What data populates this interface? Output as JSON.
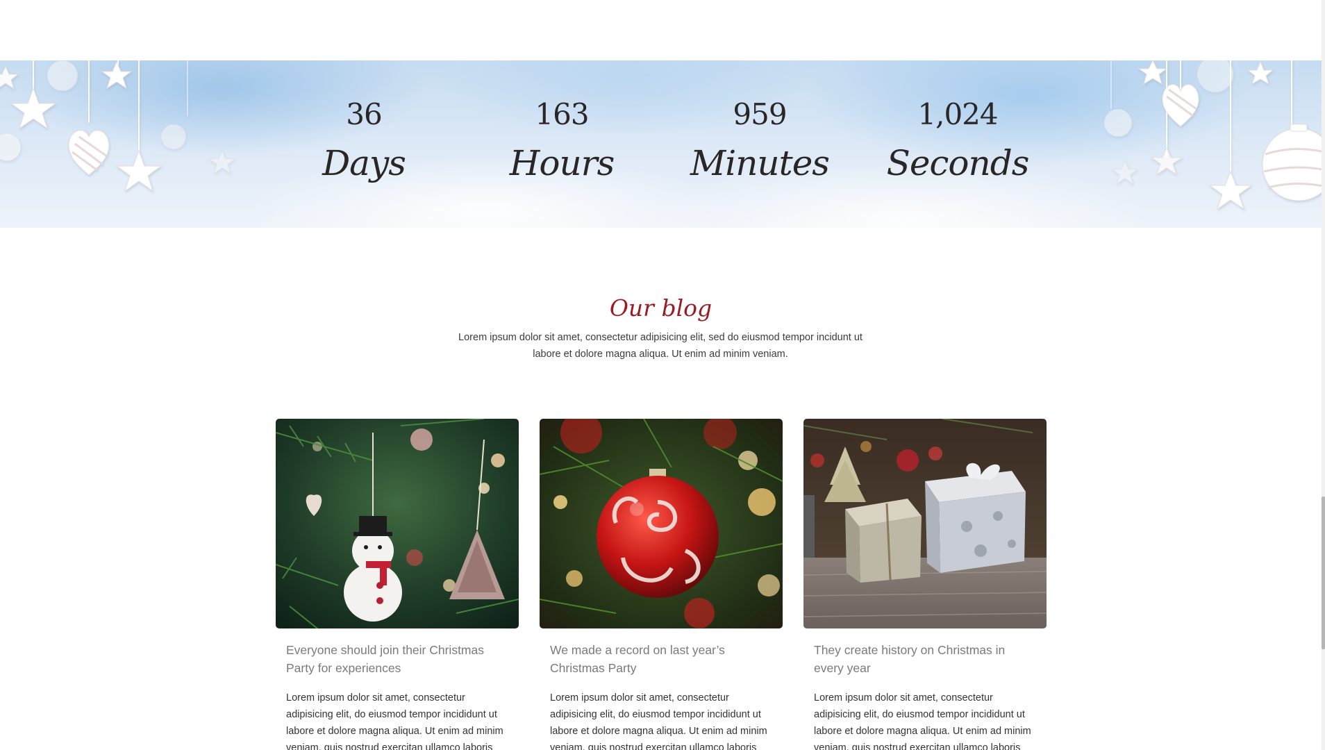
{
  "countdown": {
    "items": [
      {
        "value": "36",
        "label": "Days"
      },
      {
        "value": "163",
        "label": "Hours"
      },
      {
        "value": "959",
        "label": "Minutes"
      },
      {
        "value": "1,024",
        "label": "Seconds"
      }
    ]
  },
  "blog": {
    "title": "Our blog",
    "intro": "Lorem ipsum dolor sit amet, consectetur adipisicing elit, sed do eiusmod tempor incidunt ut labore et dolore magna aliqua. Ut enim ad minim veniam.",
    "posts": [
      {
        "title": "Everyone should join their Christmas Party for experiences",
        "excerpt": "Lorem ipsum dolor sit amet, consectetur adipisicing elit, do eiusmod tempor incididunt ut labore et dolore magna aliqua. Ut enim ad minim veniam, quis nostrud exercitan ullamco laboris nisi",
        "image": "snowman-ornament-photo"
      },
      {
        "title": "We made a record on last year’s Christmas Party",
        "excerpt": "Lorem ipsum dolor sit amet, consectetur adipisicing elit, do eiusmod tempor incididunt ut labore et dolore magna aliqua. Ut enim ad minim veniam, quis nostrud exercitan ullamco laboris nisi",
        "image": "red-bauble-photo"
      },
      {
        "title": "They create history on Christmas in every year",
        "excerpt": "Lorem ipsum dolor sit amet, consectetur adipisicing elit, do eiusmod tempor incididunt ut labore et dolore magna aliqua. Ut enim ad minim veniam, quis nostrud exercitan ullamco laboris nisi",
        "image": "gift-boxes-photo"
      }
    ]
  },
  "colors": {
    "accent": "#9b1b25",
    "countdown_text": "#2b2626",
    "card_title": "#7a7a7a"
  }
}
